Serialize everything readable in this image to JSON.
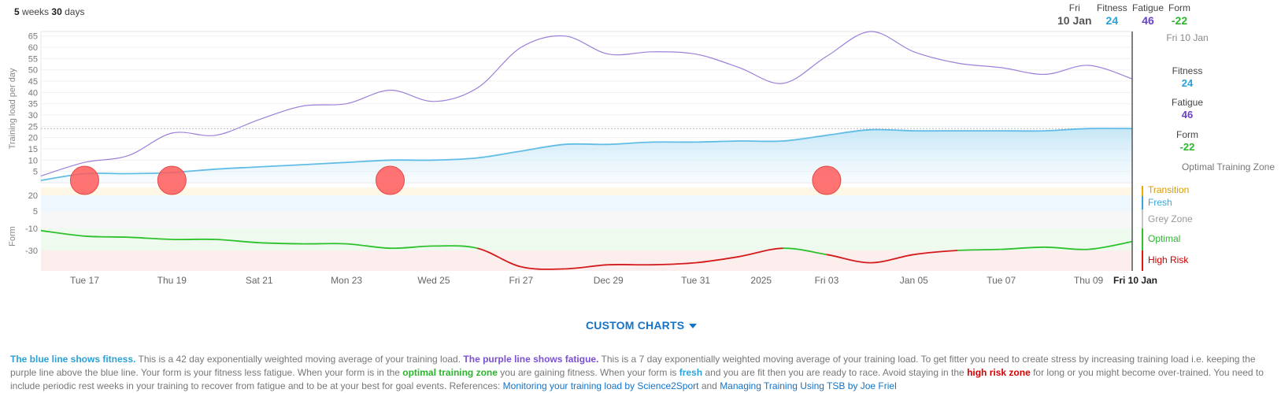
{
  "header": {
    "range_weeks": "5",
    "range_weeks_label": "weeks",
    "range_days": "30",
    "range_days_label": "days",
    "day_label": "Fri",
    "date_label": "10 Jan",
    "fitness_label": "Fitness",
    "fitness_value": "24",
    "fatigue_label": "Fatigue",
    "fatigue_value": "46",
    "form_label": "Form",
    "form_value": "-22"
  },
  "side_panel": {
    "date": "Fri 10 Jan",
    "fitness_label": "Fitness",
    "fitness_value": "24",
    "fatigue_label": "Fatigue",
    "fatigue_value": "46",
    "form_label": "Form",
    "form_value": "-22",
    "zone_label": "Optimal Training Zone"
  },
  "colors": {
    "fitness": "#62bde6",
    "fatigue": "#9c7fd9",
    "form_optimal": "#2dc22d",
    "form_high_risk": "#d41a1a",
    "form_grey": "#c4c4c4",
    "transition": "#f0a800",
    "fresh": "#37a6dc",
    "event_marker": "#ff5a5a",
    "green_text": "#2bb52b",
    "purple_text": "#6a3fd0",
    "blue_text": "#2aa1d8",
    "red_text": "#cc0000"
  },
  "chart_data": {
    "type": "line",
    "x": [
      "Dec 16",
      "Dec 17",
      "Dec 18",
      "Dec 19",
      "Dec 20",
      "Dec 21",
      "Dec 22",
      "Dec 23",
      "Dec 24",
      "Dec 25",
      "Dec 26",
      "Dec 27",
      "Dec 28",
      "Dec 29",
      "Dec 30",
      "Dec 31",
      "Jan 01",
      "Jan 02",
      "Jan 03",
      "Jan 04",
      "Jan 05",
      "Jan 06",
      "Jan 07",
      "Jan 08",
      "Jan 09",
      "Jan 10"
    ],
    "x_tick_labels": [
      "Tue 17",
      "Thu 19",
      "Sat 21",
      "Mon 23",
      "Wed 25",
      "Fri 27",
      "Dec 29",
      "Tue 31",
      "2025",
      "Fri 03",
      "Jan 05",
      "Tue 07",
      "Thu 09",
      "Fri 10 Jan"
    ],
    "series": [
      {
        "name": "Fitness",
        "values": [
          1,
          4,
          4,
          4.5,
          6,
          7,
          8,
          9,
          10,
          10,
          11,
          14,
          17,
          17,
          18,
          18,
          18.5,
          18.5,
          21,
          23.5,
          23,
          23,
          23,
          23,
          24,
          24
        ]
      },
      {
        "name": "Fatigue",
        "values": [
          3,
          9,
          12,
          22,
          21,
          28,
          34,
          35,
          41,
          36,
          42,
          60,
          65,
          57,
          58,
          57,
          51,
          44,
          56,
          67,
          58,
          53,
          51,
          48,
          52,
          46
        ]
      },
      {
        "name": "Form",
        "values": [
          -12,
          -17,
          -18,
          -20,
          -20,
          -23,
          -24,
          -24,
          -28,
          -26,
          -28,
          -38,
          -39,
          -37,
          -37,
          -36,
          -33,
          -28,
          -32,
          -36,
          -32,
          -30,
          -29,
          -27,
          -29,
          -22
        ]
      }
    ],
    "upper_panel": {
      "ylabel": "Training load per day",
      "ylim": [
        0,
        67
      ],
      "yticks": [
        5,
        10,
        15,
        20,
        25,
        30,
        35,
        40,
        45,
        50,
        55,
        60,
        65
      ],
      "reference_line": 24
    },
    "lower_panel": {
      "ylabel": "Form",
      "yticks": [
        20,
        5,
        -10,
        -30
      ]
    },
    "event_markers": [
      "Dec 17",
      "Dec 19",
      "Dec 24",
      "Jan 03"
    ],
    "zones": [
      {
        "name": "Transition",
        "color": "#f0a800"
      },
      {
        "name": "Fresh",
        "color": "#37a6dc"
      },
      {
        "name": "Grey Zone",
        "color": "#c4c4c4"
      },
      {
        "name": "Optimal",
        "color": "#2dc22d"
      },
      {
        "name": "High Risk",
        "color": "#d41a1a"
      }
    ]
  },
  "custom_charts_label": "CUSTOM CHARTS",
  "description": {
    "blue_line": "The blue line shows fitness.",
    "text1": " This is a 42 day exponentially weighted moving average of your training load. ",
    "purple_line": "The purple line shows fatigue.",
    "text2": " This is a 7 day exponentially weighted moving average of your training load. To get fitter you need to create stress by increasing training load i.e. keeping the purple line above the blue line. Your form is your fitness less fatigue. When your form is in the ",
    "optimal_zone": "optimal training zone",
    "text3": " you are gaining fitness. When your form is ",
    "fresh": "fresh",
    "text4": " and you are fit then you are ready to race. Avoid staying in the ",
    "high_risk_zone": "high risk zone",
    "text5": " for long or you might become over-trained. You need to include periodic rest weeks in your training to recover from fatigue and to be at your best for goal events. References: ",
    "link1": "Monitoring your training load by Science2Sport",
    "and": " and ",
    "link2": "Managing Training Using TSB by Joe Friel"
  }
}
